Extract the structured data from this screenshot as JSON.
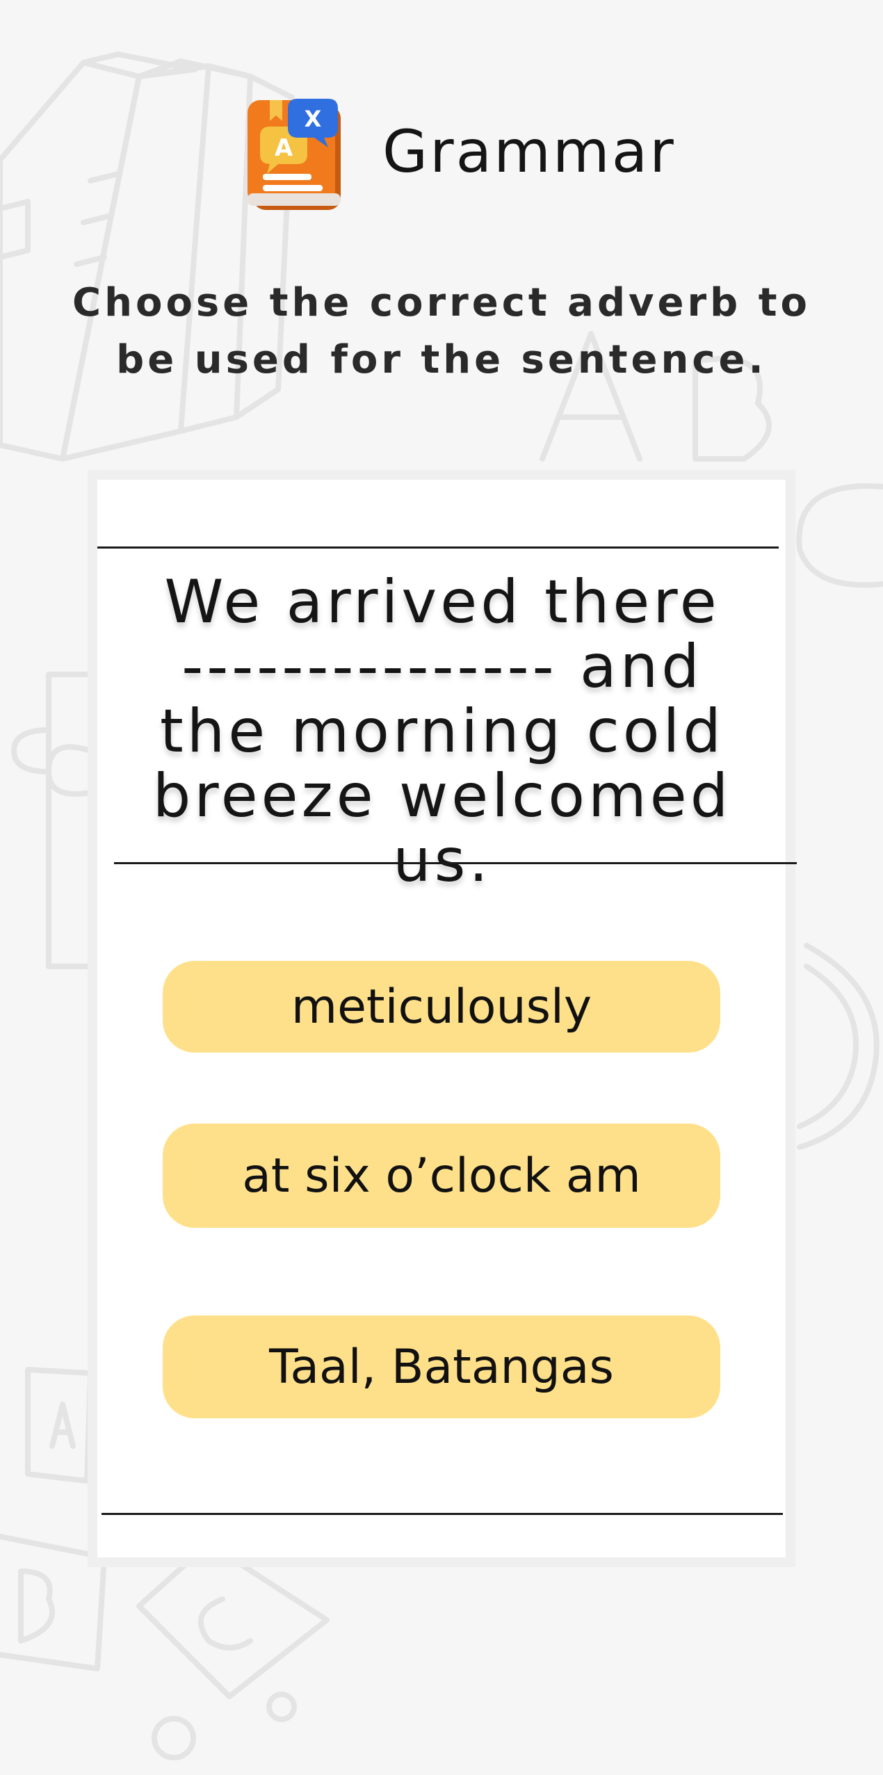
{
  "header": {
    "title": "Grammar",
    "icon": "grammar-book-icon"
  },
  "instruction": "Choose the correct adverb to\nbe used for the sentence.",
  "question": {
    "sentence": "We arrived there\n--------------- and\nthe morning cold\nbreeze welcomed us."
  },
  "options": [
    {
      "label": "meticulously"
    },
    {
      "label": "at six o’clock am"
    },
    {
      "label": "Taal, Batangas"
    }
  ],
  "colors": {
    "background": "#f6f6f6",
    "card": "#ffffff",
    "option_fill": "#ffe08a",
    "icon_book": "#f07a1c",
    "icon_bubble_yellow": "#f5c242",
    "icon_bubble_blue": "#2f6fe0"
  }
}
